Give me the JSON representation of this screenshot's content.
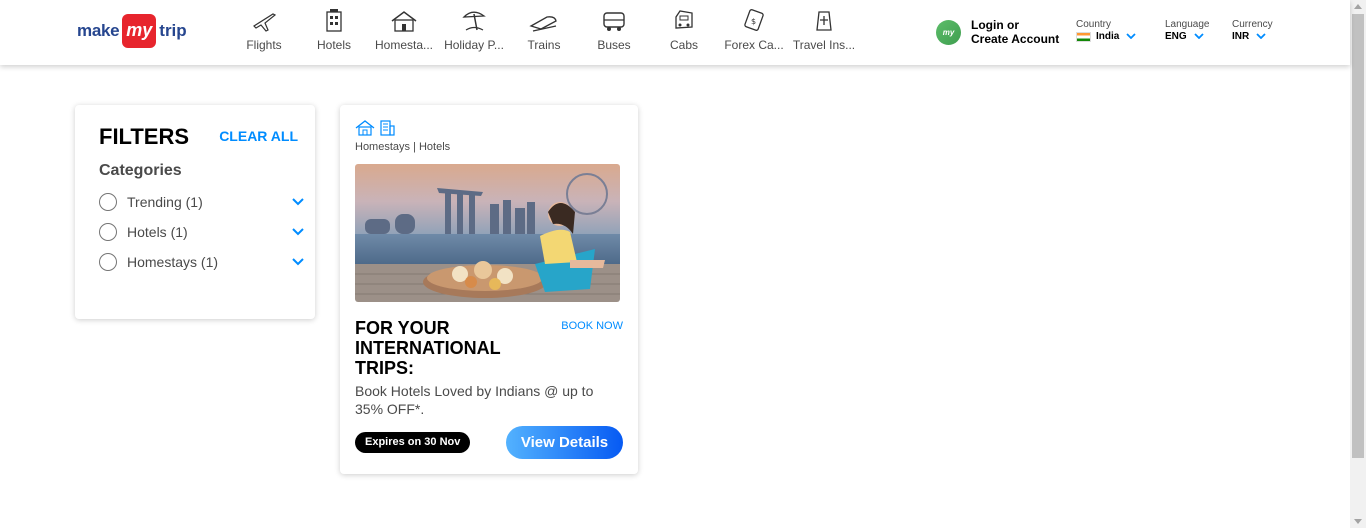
{
  "brand": {
    "make": "make",
    "my": "my",
    "trip": "trip"
  },
  "nav": [
    {
      "label": "Flights",
      "icon": "flight-icon"
    },
    {
      "label": "Hotels",
      "icon": "hotel-icon"
    },
    {
      "label": "Homesta...",
      "icon": "homestay-icon"
    },
    {
      "label": "Holiday P...",
      "icon": "holiday-package-icon"
    },
    {
      "label": "Trains",
      "icon": "train-icon"
    },
    {
      "label": "Buses",
      "icon": "bus-icon"
    },
    {
      "label": "Cabs",
      "icon": "cab-icon"
    },
    {
      "label": "Forex Ca...",
      "icon": "forex-card-icon"
    },
    {
      "label": "Travel Ins...",
      "icon": "travel-insurance-icon"
    }
  ],
  "account": {
    "avatar_text": "my",
    "line1": "Login or",
    "line2": "Create Account"
  },
  "country": {
    "caption": "Country",
    "value": "India"
  },
  "language": {
    "caption": "Language",
    "value": "ENG"
  },
  "currency": {
    "caption": "Currency",
    "value": "INR"
  },
  "filters": {
    "title": "FILTERS",
    "clear_all": "CLEAR ALL",
    "categories_heading": "Categories",
    "items": [
      {
        "label": "Trending (1)",
        "checked": false
      },
      {
        "label": "Hotels (1)",
        "checked": false
      },
      {
        "label": "Homestays (1)",
        "checked": false
      }
    ]
  },
  "offer": {
    "category_icons": [
      "homestay-icon",
      "hotel-icon"
    ],
    "categories": "Homestays | Hotels",
    "headline": "FOR YOUR INTERNATIONAL TRIPS:",
    "book_now": "BOOK NOW",
    "description": "Book Hotels Loved by Indians @ up to 35% OFF*.",
    "expiry": "Expires on 30 Nov",
    "cta": "View Details"
  },
  "colors": {
    "accent": "#008cff",
    "brand_red": "#e7252d",
    "brand_blue": "#26468f",
    "cta_start": "#53b2fe",
    "cta_end": "#065af3"
  }
}
